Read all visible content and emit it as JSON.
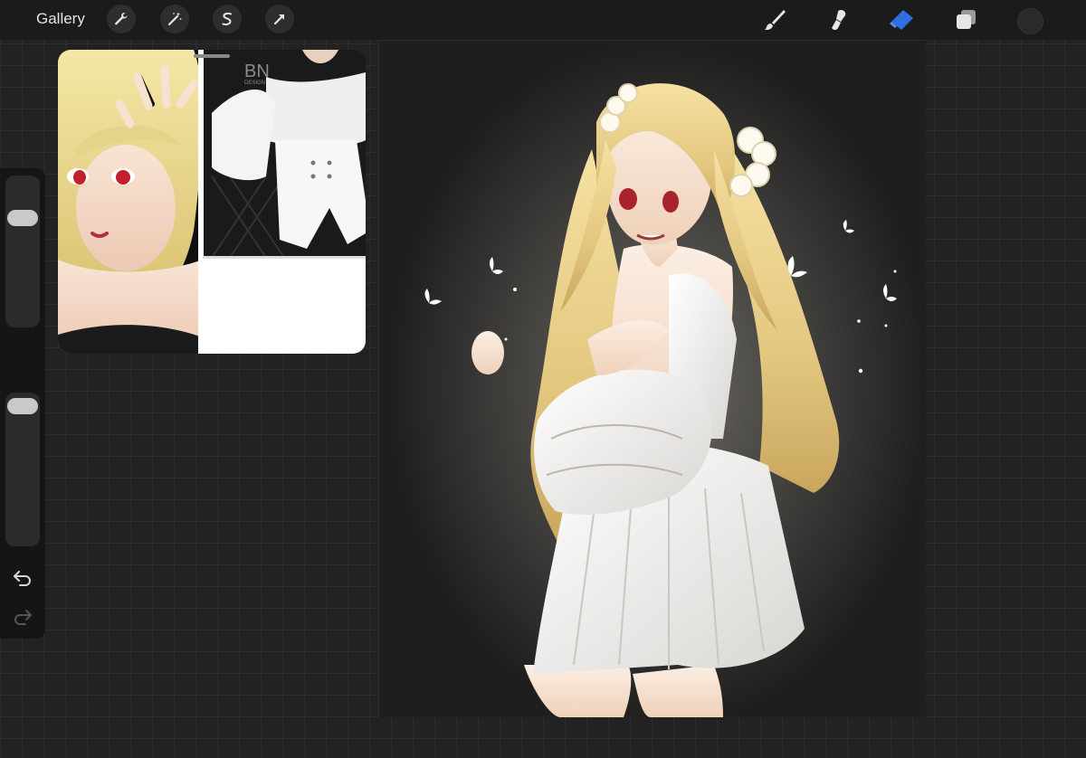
{
  "topbar": {
    "gallery_label": "Gallery",
    "left_tools": [
      "wrench-icon",
      "magic-wand-icon",
      "selection-icon",
      "transform-arrow-icon"
    ],
    "right_tools": [
      "brush-icon",
      "smudge-icon",
      "eraser-icon",
      "layers-icon"
    ],
    "active_tool": "eraser",
    "accent_color": "#2f6fe0",
    "current_color": "#2a2a2a"
  },
  "sidebar": {
    "brush_size_level": 0.1,
    "opacity_level": 0.05,
    "controls": [
      "brush-size-slider",
      "modify-button",
      "opacity-slider",
      "undo-icon",
      "redo-icon"
    ]
  },
  "reference": {
    "left_panel": "anime portrait, blonde girl with red eyes",
    "right_panel": "white off-shoulder blouse and shorts",
    "logo_text": "BN",
    "logo_sub": "DESIGN"
  },
  "canvas": {
    "description": "illustration of blonde girl in white dress with glowing butterflies",
    "background": "#1e1e1e"
  }
}
